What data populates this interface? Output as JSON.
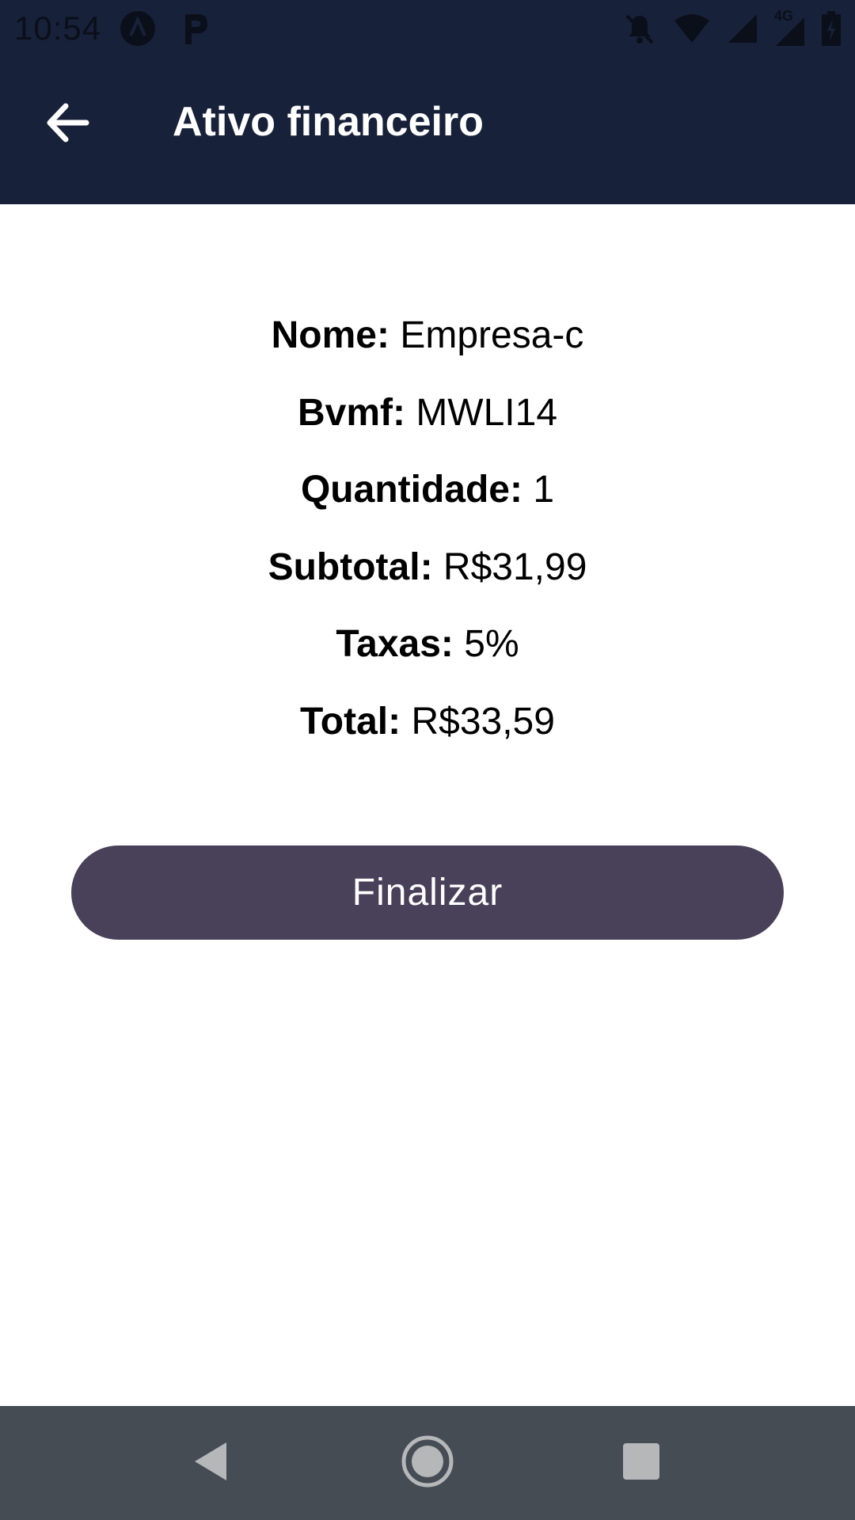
{
  "status_bar": {
    "time": "10:54",
    "icons": [
      "app-a-icon",
      "app-p-icon",
      "notifications-off-icon",
      "wifi-icon",
      "signal-icon",
      "signal-4g-icon",
      "battery-charging-icon"
    ],
    "network_label": "4G"
  },
  "app_bar": {
    "title": "Ativo financeiro",
    "back_icon": "arrow-left-icon",
    "background": "#172139"
  },
  "details": [
    {
      "label": "Nome:",
      "value": "Empresa-c"
    },
    {
      "label": "Bvmf:",
      "value": "MWLI14"
    },
    {
      "label": "Quantidade:",
      "value": "1"
    },
    {
      "label": "Subtotal:",
      "value": "R$31,99"
    },
    {
      "label": "Taxas:",
      "value": "5%"
    },
    {
      "label": "Total:",
      "value": "R$33,59"
    }
  ],
  "actions": {
    "finalize_label": "Finalizar",
    "finalize_color": "#494059"
  },
  "nav_bar": {
    "items": [
      "back-triangle-icon",
      "home-circle-icon",
      "recents-square-icon"
    ],
    "background": "#454c54"
  }
}
